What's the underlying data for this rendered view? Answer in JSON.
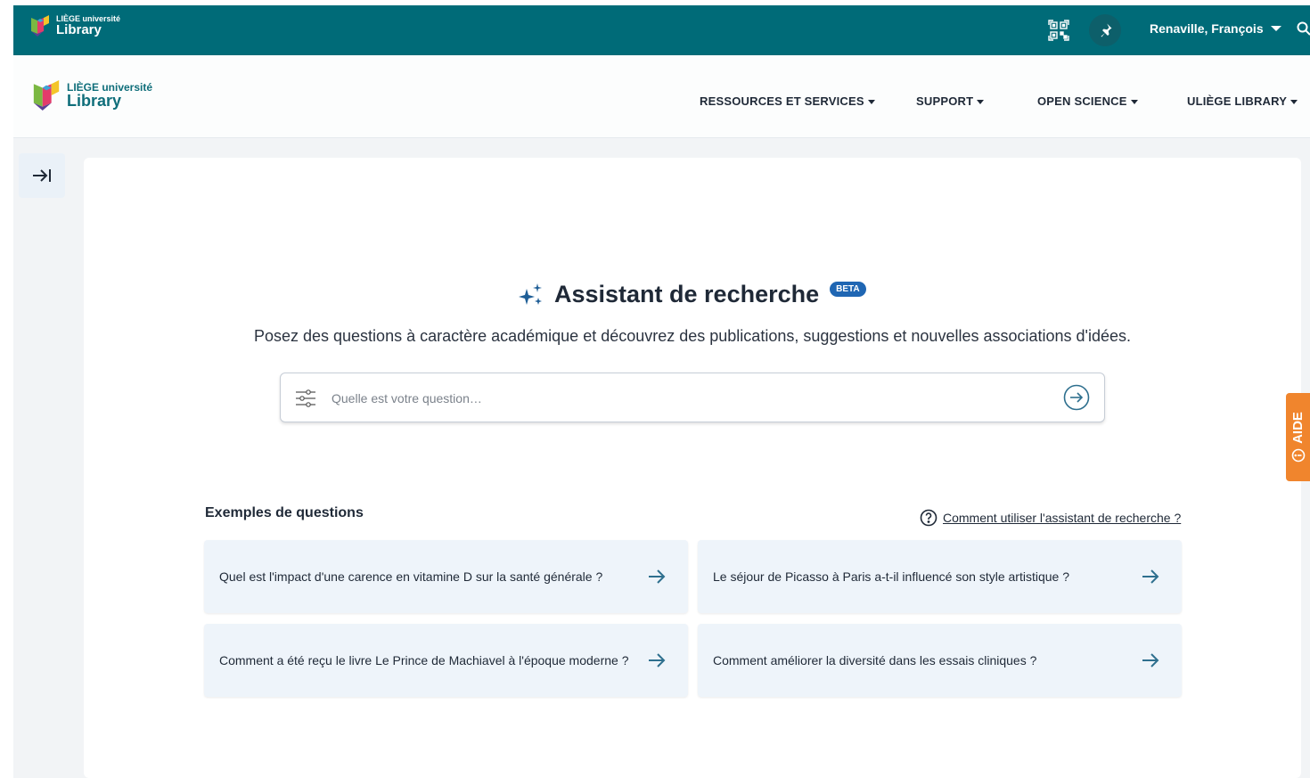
{
  "topbar": {
    "logo_small": "LIÈGE université",
    "logo_big": "Library",
    "user_name": "Renaville, François"
  },
  "header": {
    "logo_small": "LIÈGE université",
    "logo_big": "Library",
    "nav": [
      {
        "label": "RESSOURCES ET SERVICES"
      },
      {
        "label": "SUPPORT"
      },
      {
        "label": "OPEN SCIENCE"
      },
      {
        "label": "ULIÈGE LIBRARY"
      }
    ]
  },
  "hero": {
    "title": "Assistant de recherche",
    "badge": "BETA",
    "subtitle": "Posez des questions à caractère académique et découvrez des publications, suggestions et nouvelles associations d'idées."
  },
  "search": {
    "placeholder": "Quelle est votre question…",
    "value": ""
  },
  "examples": {
    "label": "Exemples de questions",
    "help_link": "Comment utiliser l'assistant de recherche ?",
    "items": [
      {
        "text": "Quel est l'impact d'une carence en vitamine D sur la santé générale ?"
      },
      {
        "text": "Le séjour de Picasso à Paris a-t-il influencé son style artistique ?"
      },
      {
        "text": "Comment a été reçu le livre Le Prince de Machiavel à l'époque moderne ?"
      },
      {
        "text": "Comment améliorer la diversité dans les essais cliniques ?"
      }
    ]
  },
  "aide": {
    "label": "AIDE"
  },
  "colors": {
    "topbar": "#006b78",
    "brand_teal": "#0f6e7a",
    "beta_badge": "#1f66b3",
    "card_bg": "#eef4fa",
    "arrow": "#2e6f8e",
    "aide_tab": "#f0852d"
  },
  "icons": {
    "qr": "qr-code-icon",
    "pin": "pin-icon",
    "user_caret": "caret-down-icon",
    "search": "search-icon",
    "sidebar_toggle": "expand-sidebar-icon",
    "sparkle": "sparkle-icon",
    "filter": "filter-sliders-icon",
    "submit": "arrow-circle-right-icon",
    "help": "question-circle-icon",
    "card_arrow": "arrow-right-icon",
    "aide": "info-circle-icon"
  }
}
